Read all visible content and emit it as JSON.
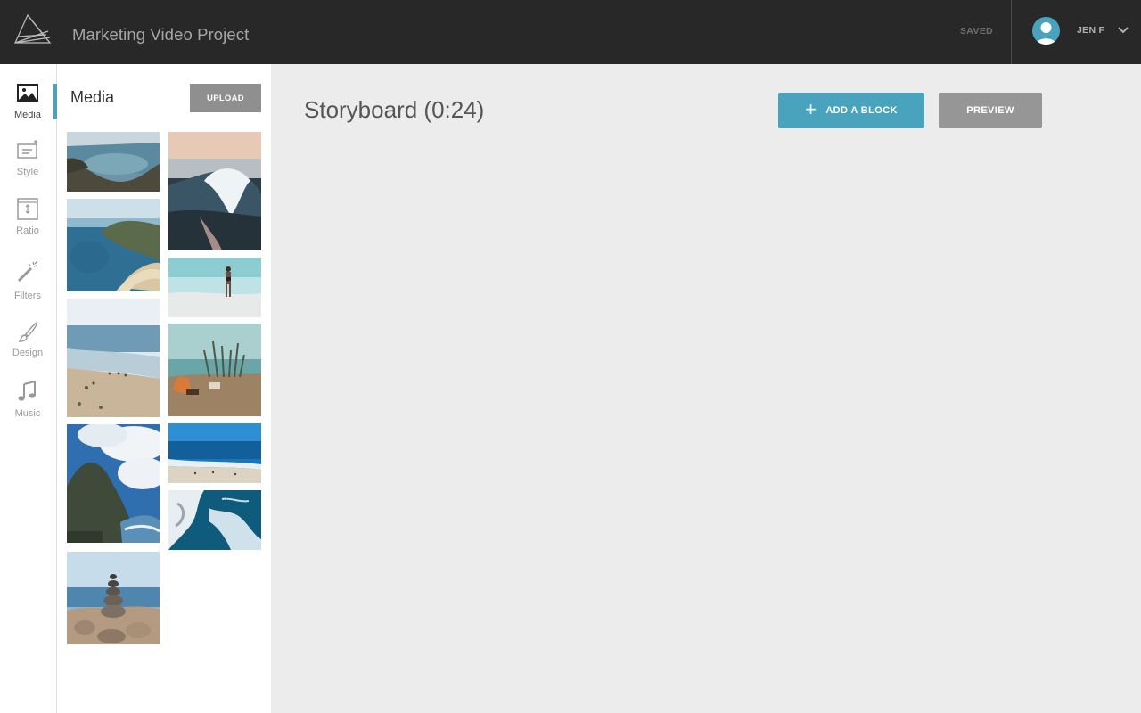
{
  "header": {
    "project_title": "Marketing Video Project",
    "save_status": "SAVED",
    "user_name": "JEN F",
    "accent_color": "#4aa3bd",
    "bar_color": "#282828"
  },
  "rail": {
    "items": [
      {
        "label": "Media",
        "icon": "image-icon",
        "active": true
      },
      {
        "label": "Style",
        "icon": "style-icon"
      },
      {
        "label": "Ratio",
        "icon": "ratio-icon"
      },
      {
        "label": "Filters",
        "icon": "magic-wand-icon"
      },
      {
        "label": "Design",
        "icon": "brush-icon"
      },
      {
        "label": "Music",
        "icon": "music-note-icon"
      }
    ]
  },
  "media_panel": {
    "title": "Media",
    "upload_label": "UPLOAD",
    "thumbnails": [
      "coastal-cove",
      "breaking-wave",
      "cliff-and-beach",
      "person-in-shallow-water",
      "crowded-beach",
      "beach-campfire",
      "rocky-mountain-clouds",
      "blue-ocean-shore",
      "aerial-surf",
      "stone-cairn"
    ]
  },
  "main": {
    "title": "Storyboard (0:24)",
    "add_block_label": "ADD A BLOCK",
    "preview_label": "PREVIEW"
  }
}
